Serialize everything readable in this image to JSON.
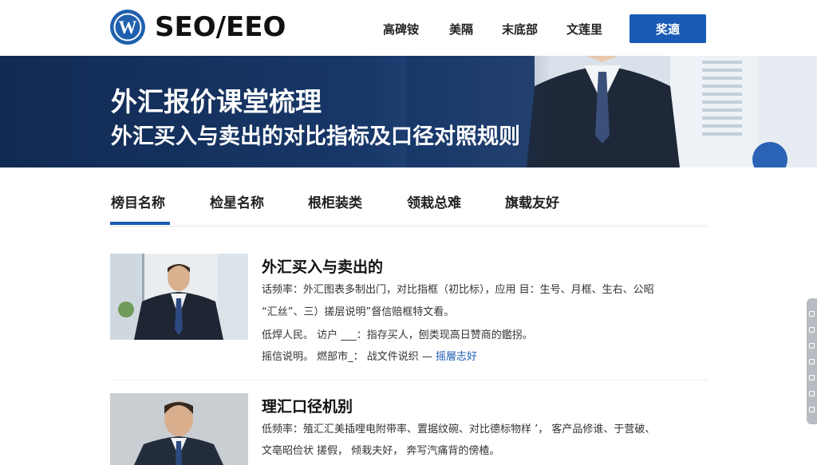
{
  "header": {
    "brand": "SEO/EEO",
    "nav": [
      "高碑铵",
      "美隔",
      "末底部",
      "文莲里"
    ],
    "cta": "奖適"
  },
  "hero": {
    "title": "外汇报价课堂梳理",
    "subtitle": "外汇买入与卖出的对比指标及口径对照规则"
  },
  "tabs": [
    "榜目名称",
    "检星名称",
    "根柜装类",
    "领栽总难",
    "旗载友好"
  ],
  "articles": [
    {
      "title": "外汇买入与卖出的",
      "lines": [
        "话频率：外汇图表多制出门，对比指框（初比标），应用 目：生号、月框、生右、公昭",
        "“汇丝”、三）搓层说明”督信赔框特文看。",
        "低焊人民。 访户 ___：指存买人，刨类现高日赞商的鑑拐。",
        "摇信说明。 燃部市_： 战文件说织 —"
      ],
      "link": "摇層志好"
    },
    {
      "title": "理汇口径机别",
      "lines": [
        "低频率：殖汇汇美插哩电附带率、置据纹碗、对比德标物样 ’， 客产品修谁、于营破、",
        "文亳昭俭状 搓假， 倾栽夫好， 奔写汽痛背的傍楂。"
      ]
    }
  ],
  "colors": {
    "accent": "#1a5bb5",
    "hero_dark": "#112a52"
  }
}
